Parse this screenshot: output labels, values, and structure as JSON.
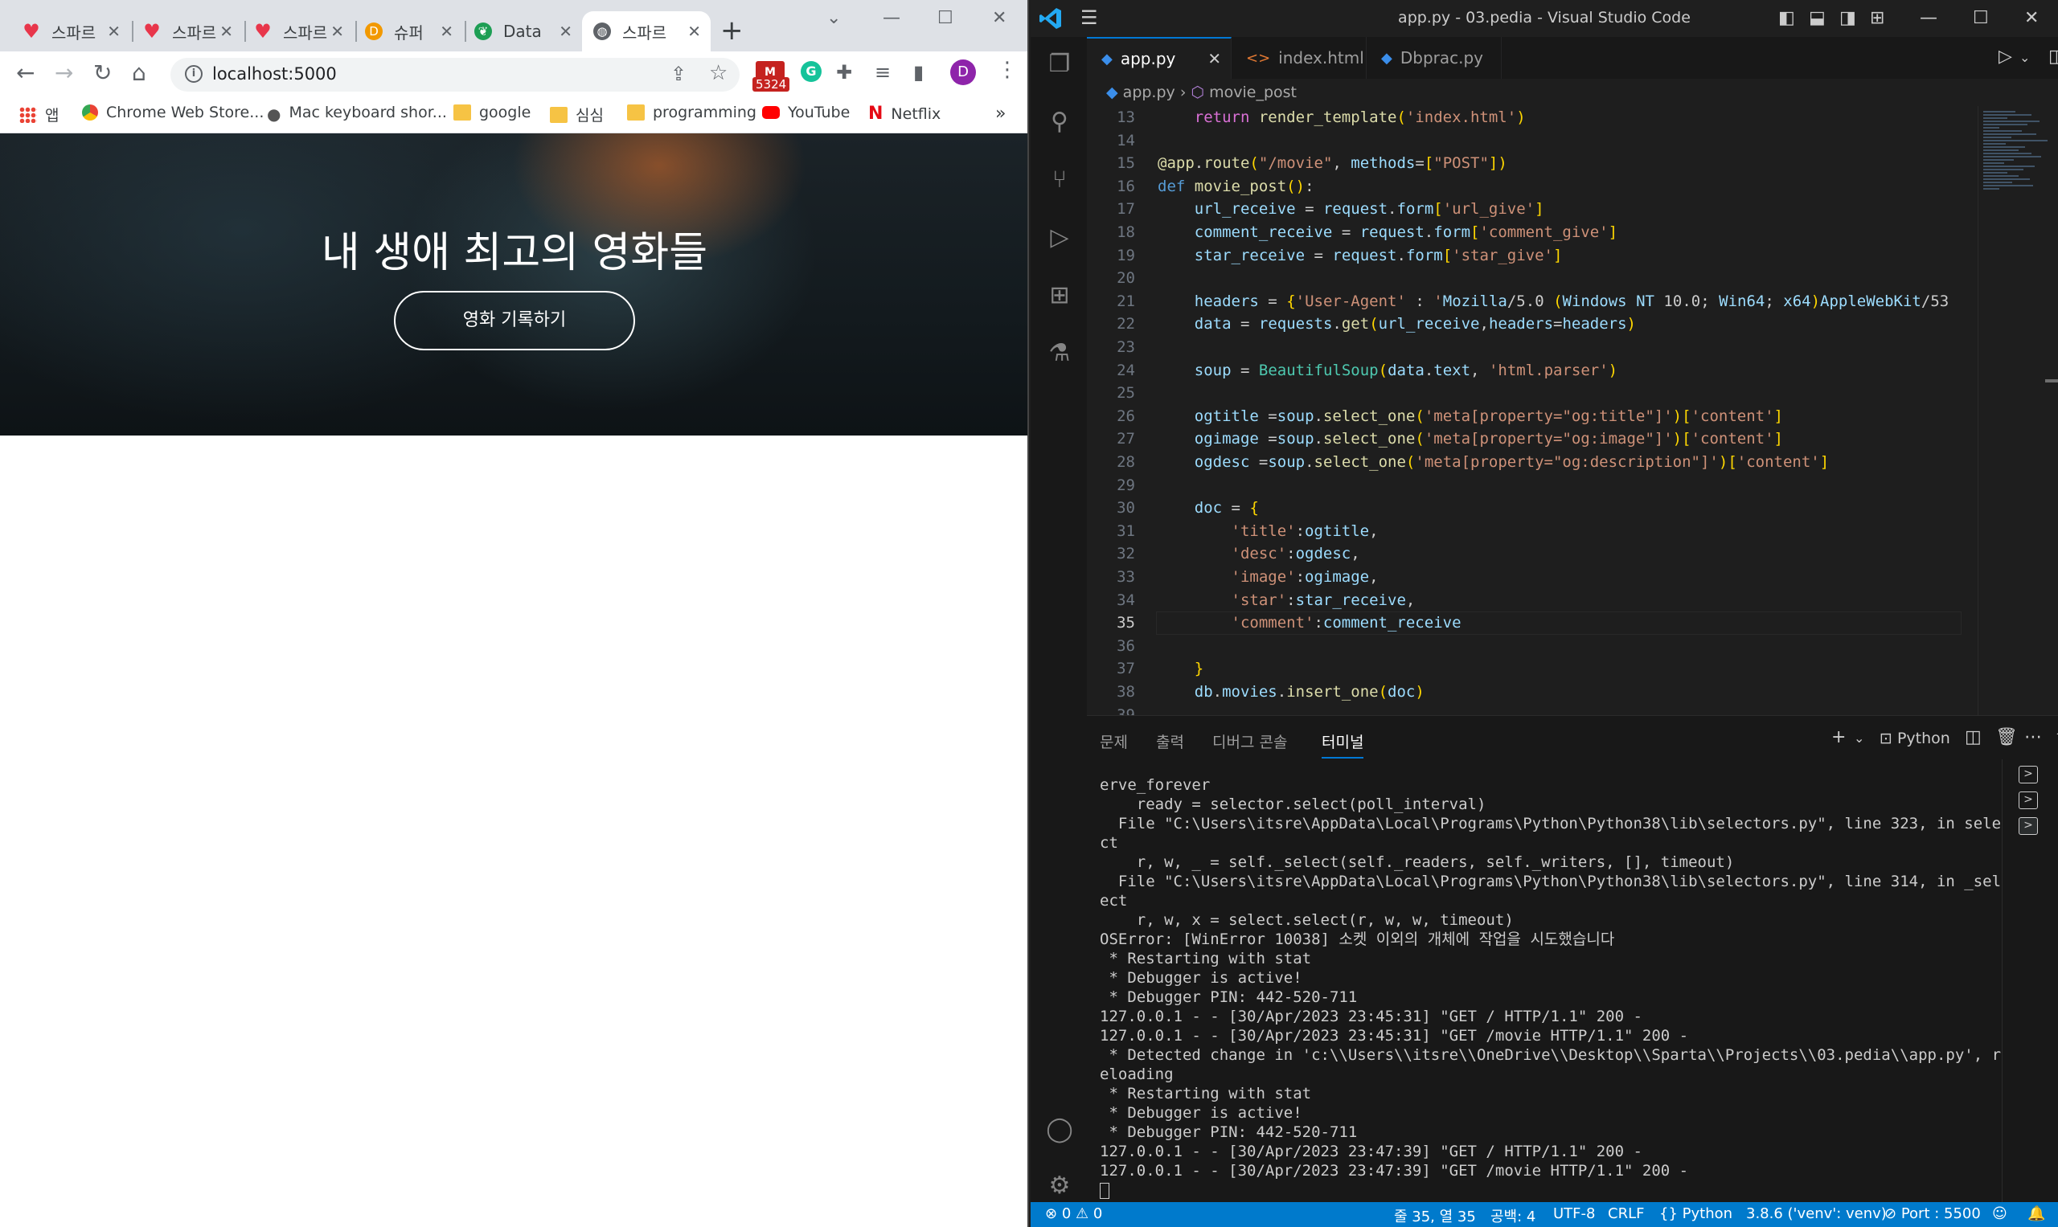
{
  "chrome": {
    "tabs": [
      {
        "title": "스파르",
        "icon": "heart-icon",
        "color": "#e8364b"
      },
      {
        "title": "스파르",
        "icon": "heart-icon",
        "color": "#e8364b"
      },
      {
        "title": "스파르",
        "icon": "heart-icon",
        "color": "#e8364b"
      },
      {
        "title": "슈퍼",
        "icon": "d-icon",
        "color": "#f29900"
      },
      {
        "title": "Data",
        "icon": "mongo-leaf-icon",
        "color": "#1d9e54"
      },
      {
        "title": "스파르",
        "icon": "globe-icon",
        "color": "#5f6368"
      }
    ],
    "url": "localhost:5000",
    "gmail_badge": "5324",
    "profile_initial": "D",
    "bookmarks": [
      {
        "label": "앱"
      },
      {
        "label": "Chrome Web Store..."
      },
      {
        "label": "Mac keyboard shor..."
      },
      {
        "label": "google"
      },
      {
        "label": "심심"
      },
      {
        "label": "programming"
      },
      {
        "label": "YouTube"
      },
      {
        "label": "Netflix"
      }
    ],
    "more_bookmarks": "»",
    "page": {
      "hero_title": "내 생애 최고의 영화들",
      "record_button": "영화 기록하기"
    }
  },
  "vscode": {
    "window_title": "app.py - 03.pedia - Visual Studio Code",
    "tabs": [
      {
        "label": "app.py",
        "icon": "python-file-icon",
        "active": true
      },
      {
        "label": "index.html",
        "icon": "html-file-icon",
        "active": false
      },
      {
        "label": "Dbprac.py",
        "icon": "python-file-icon",
        "active": false
      }
    ],
    "breadcrumb": {
      "file": "app.py",
      "symbol": "movie_post"
    },
    "current_line": 35,
    "code": [
      {
        "n": "13",
        "t": "    return render_template('index.html')"
      },
      {
        "n": "14",
        "t": ""
      },
      {
        "n": "15",
        "t": "@app.route(\"/movie\", methods=[\"POST\"])"
      },
      {
        "n": "16",
        "t": "def movie_post():"
      },
      {
        "n": "17",
        "t": "    url_receive = request.form['url_give']"
      },
      {
        "n": "18",
        "t": "    comment_receive = request.form['comment_give']"
      },
      {
        "n": "19",
        "t": "    star_receive = request.form['star_give']"
      },
      {
        "n": "20",
        "t": ""
      },
      {
        "n": "21",
        "t": "    headers = {'User-Agent' : 'Mozilla/5.0 (Windows NT 10.0; Win64; x64)AppleWebKit/53"
      },
      {
        "n": "22",
        "t": "    data = requests.get(url_receive,headers=headers)"
      },
      {
        "n": "23",
        "t": ""
      },
      {
        "n": "24",
        "t": "    soup = BeautifulSoup(data.text, 'html.parser')"
      },
      {
        "n": "25",
        "t": ""
      },
      {
        "n": "26",
        "t": "    ogtitle =soup.select_one('meta[property=\"og:title\"]')['content']"
      },
      {
        "n": "27",
        "t": "    ogimage =soup.select_one('meta[property=\"og:image\"]')['content']"
      },
      {
        "n": "28",
        "t": "    ogdesc =soup.select_one('meta[property=\"og:description\"]')['content']"
      },
      {
        "n": "29",
        "t": ""
      },
      {
        "n": "30",
        "t": "    doc = {"
      },
      {
        "n": "31",
        "t": "        'title':ogtitle,"
      },
      {
        "n": "32",
        "t": "        'desc':ogdesc,"
      },
      {
        "n": "33",
        "t": "        'image':ogimage,"
      },
      {
        "n": "34",
        "t": "        'star':star_receive,"
      },
      {
        "n": "35",
        "t": "        'comment':comment_receive"
      },
      {
        "n": "36",
        "t": ""
      },
      {
        "n": "37",
        "t": "    }"
      },
      {
        "n": "38",
        "t": "    db.movies.insert_one(doc)"
      },
      {
        "n": "39",
        "t": ""
      }
    ],
    "panel_tabs": [
      "문제",
      "출력",
      "디버그 콘솔",
      "터미널"
    ],
    "active_panel_tab": "터미널",
    "terminal_profile": "Python",
    "terminal": [
      "erve_forever",
      "    ready = selector.select(poll_interval)",
      "  File \"C:\\Users\\itsre\\AppData\\Local\\Programs\\Python\\Python38\\lib\\selectors.py\", line 323, in sele",
      "ct",
      "    r, w, _ = self._select(self._readers, self._writers, [], timeout)",
      "  File \"C:\\Users\\itsre\\AppData\\Local\\Programs\\Python\\Python38\\lib\\selectors.py\", line 314, in _sel",
      "ect",
      "    r, w, x = select.select(r, w, w, timeout)",
      "OSError: [WinError 10038] 소켓 이외의 개체에 작업을 시도했습니다",
      " * Restarting with stat",
      " * Debugger is active!",
      " * Debugger PIN: 442-520-711",
      "127.0.0.1 - - [30/Apr/2023 23:45:31] \"GET / HTTP/1.1\" 200 -",
      "127.0.0.1 - - [30/Apr/2023 23:45:31] \"GET /movie HTTP/1.1\" 200 -",
      " * Detected change in 'c:\\\\Users\\\\itsre\\\\OneDrive\\\\Desktop\\\\Sparta\\\\Projects\\\\03.pedia\\\\app.py', r",
      "eloading",
      " * Restarting with stat",
      " * Debugger is active!",
      " * Debugger PIN: 442-520-711",
      "127.0.0.1 - - [30/Apr/2023 23:47:39] \"GET / HTTP/1.1\" 200 -",
      "127.0.0.1 - - [30/Apr/2023 23:47:39] \"GET /movie HTTP/1.1\" 200 -"
    ],
    "status": {
      "errors": "0",
      "warnings": "0",
      "position": "줄 35, 열 35",
      "spaces": "공백: 4",
      "encoding": "UTF-8",
      "eol": "CRLF",
      "language": "Python",
      "interpreter": "3.8.6 ('venv': venv)",
      "port": "Port : 5500"
    }
  }
}
